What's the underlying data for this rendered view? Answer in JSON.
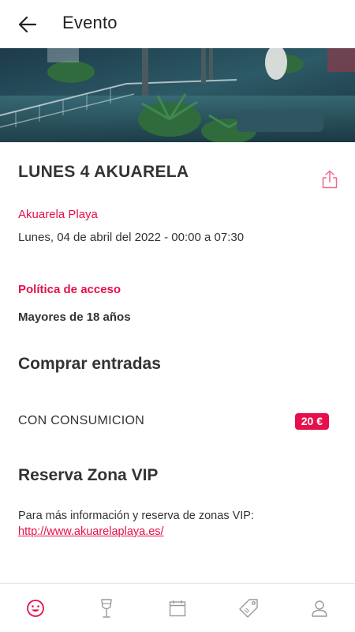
{
  "appbar": {
    "title": "Evento",
    "back_icon": "arrow-left-icon"
  },
  "hero": {
    "image": "venue-night-photo"
  },
  "event": {
    "title": "LUNES 4 AKUARELA",
    "venue": "Akuarela Playa",
    "date": "Lunes, 04 de abril del 2022 - 00:00 a 07:30",
    "share_icon": "share-icon"
  },
  "access": {
    "label": "Política de acceso",
    "value": "Mayores de 18 años"
  },
  "tickets": {
    "title": "Comprar entradas",
    "items": [
      {
        "name": "CON CONSUMICION",
        "price": "20 €"
      }
    ]
  },
  "vip": {
    "title": "Reserva Zona VIP",
    "info": "Para más información y reserva de zonas VIP:",
    "link": "http://www.akuarelaplaya.es/"
  },
  "bottom_nav": {
    "items": [
      {
        "icon": "smiley-icon",
        "active": true
      },
      {
        "icon": "wine-glass-icon",
        "active": false
      },
      {
        "icon": "calendar-icon",
        "active": false
      },
      {
        "icon": "tag-icon",
        "active": false
      },
      {
        "icon": "user-icon",
        "active": false
      }
    ]
  },
  "colors": {
    "accent": "#e5104b",
    "text": "#333333",
    "icon_inactive": "#999999"
  }
}
